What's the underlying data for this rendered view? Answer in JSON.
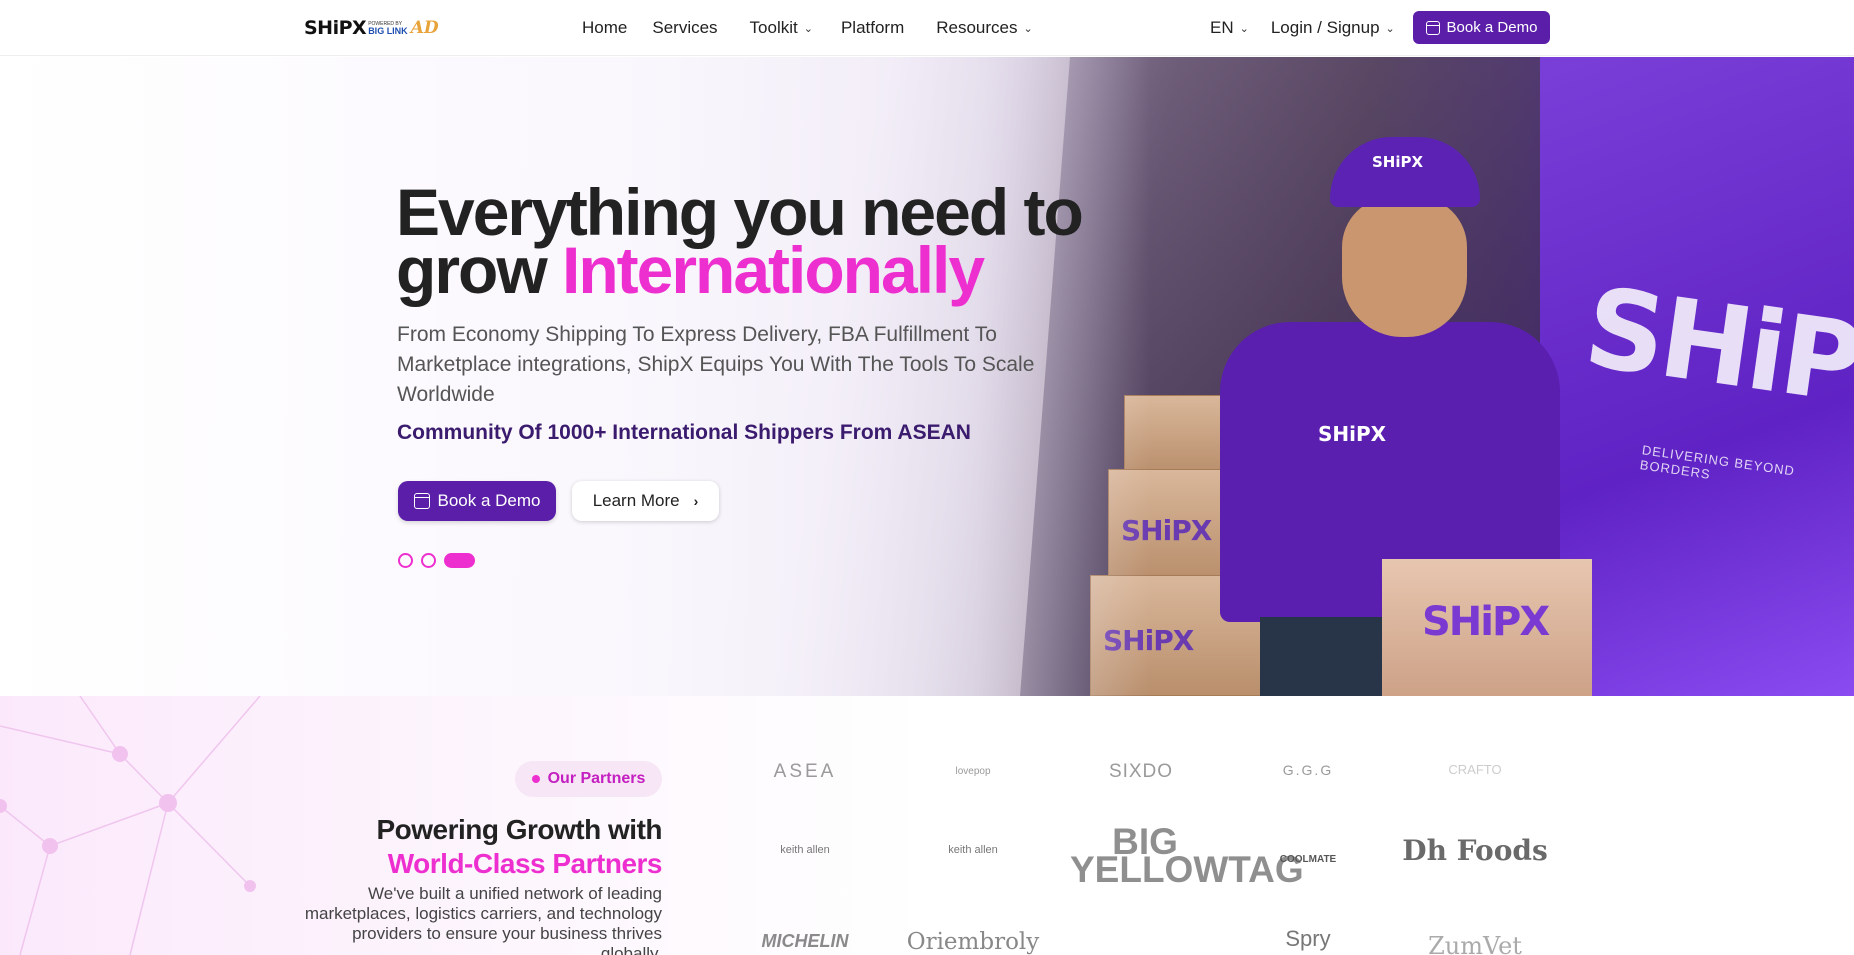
{
  "nav": {
    "logo_text": "SHiPX",
    "logo_powered": "POWERED BY",
    "logo_partner": "BIG LINK",
    "logo_ad": "AD",
    "links": [
      "Home",
      "Services",
      "Toolkit",
      "Platform",
      "Resources"
    ],
    "language": "EN",
    "login": "Login / Signup",
    "demo_button": "Book a Demo"
  },
  "hero": {
    "title_line1": "Everything you need to",
    "title_line2_plain": "grow",
    "title_line2_accent": "Internationally",
    "subtitle": "From Economy Shipping To Express Delivery, FBA Fulfillment To Marketplace integrations, ShipX Equips You With The Tools To Scale Worldwide",
    "community": "Community Of 1000+ International Shippers From ASEAN",
    "demo_button": "Book a Demo",
    "learn_button": "Learn More",
    "slides_total": 3,
    "slide_active": 3,
    "image_text": {
      "truck_brand": "SHiPX",
      "truck_tagline": "DELIVERING BEYOND BORDERS",
      "cap_logo": "SHiPX",
      "shirt_logo": "SHiPX",
      "box_logo": "SHiPX"
    }
  },
  "partners": {
    "badge": "Our Partners",
    "heading_line1": "Powering Growth with",
    "heading_line2": "World-Class Partners",
    "description": "We've built a unified network of leading marketplaces, logistics carriers, and technology providers to ensure your business thrives globally.",
    "logos": [
      "ASEA",
      "lovepop",
      "SIXDO",
      "G.G.G",
      "CRAFTO",
      "keith allen",
      "keith allen",
      "BIG YELLOWTAG",
      "COOLMATE",
      "Dh Foods",
      "MICHELIN",
      "Oriembroly",
      "",
      "Spry",
      "ZumVet"
    ]
  },
  "colors": {
    "brand_purple": "#5b1ea8",
    "accent_pink": "#ee2fd0",
    "community_text": "#3a1b6e"
  }
}
